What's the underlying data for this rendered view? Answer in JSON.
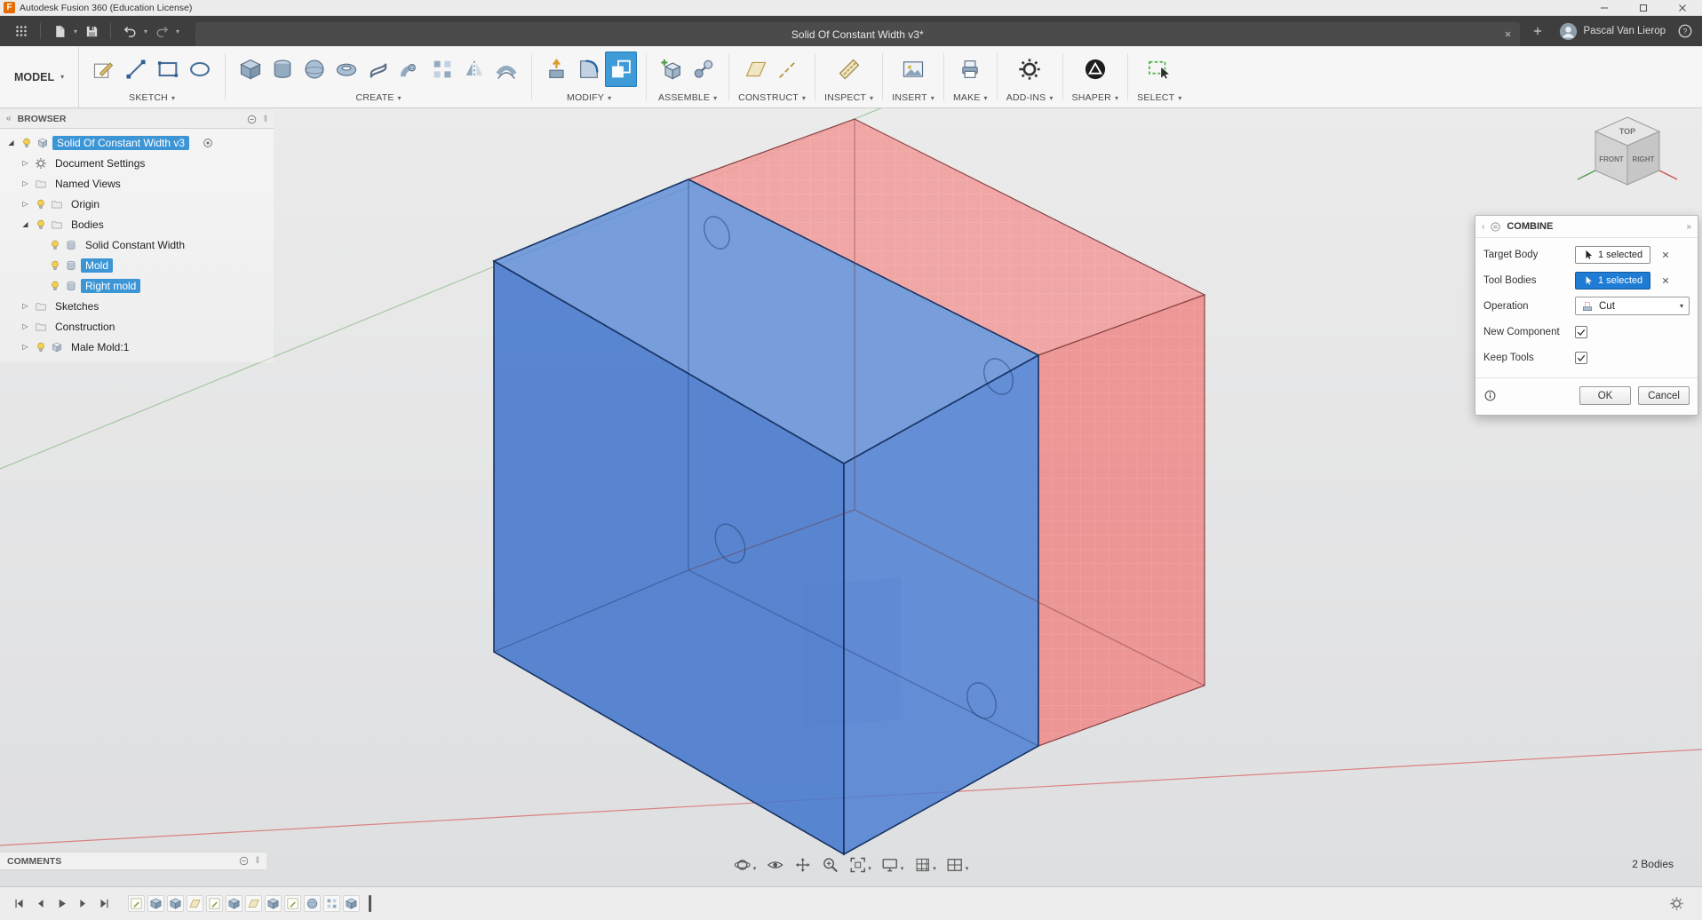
{
  "window": {
    "title": "Autodesk Fusion 360 (Education License)"
  },
  "appbar": {
    "tab_title": "Solid Of Constant Width v3*",
    "user_name": "Pascal Van Lierop"
  },
  "ribbon": {
    "workspace": "MODEL",
    "groups": [
      {
        "label": "SKETCH",
        "icons": [
          {
            "name": "create-sketch"
          },
          {
            "name": "sketch-line"
          },
          {
            "name": "sketch-rectangle"
          },
          {
            "name": "sketch-ellipse"
          }
        ]
      },
      {
        "label": "CREATE",
        "icons": [
          {
            "name": "box"
          },
          {
            "name": "cylinder"
          },
          {
            "name": "sphere"
          },
          {
            "name": "torus"
          },
          {
            "name": "coil"
          },
          {
            "name": "pipe"
          },
          {
            "name": "pattern"
          },
          {
            "name": "mirror"
          },
          {
            "name": "thicken"
          }
        ]
      },
      {
        "label": "MODIFY",
        "icons": [
          {
            "name": "press-pull"
          },
          {
            "name": "fillet"
          },
          {
            "name": "combine",
            "active": true
          }
        ]
      },
      {
        "label": "ASSEMBLE",
        "icons": [
          {
            "name": "new-component"
          },
          {
            "name": "joint"
          }
        ]
      },
      {
        "label": "CONSTRUCT",
        "icons": [
          {
            "name": "construction-plane"
          },
          {
            "name": "construction-axis"
          }
        ]
      },
      {
        "label": "INSPECT",
        "icons": [
          {
            "name": "measure"
          }
        ]
      },
      {
        "label": "INSERT",
        "icons": [
          {
            "name": "insert-image"
          }
        ]
      },
      {
        "label": "MAKE",
        "icons": [
          {
            "name": "make"
          }
        ]
      },
      {
        "label": "ADD-INS",
        "icons": [
          {
            "name": "scripts-addins"
          }
        ]
      },
      {
        "label": "SHAPER",
        "icons": [
          {
            "name": "shaper"
          }
        ]
      },
      {
        "label": "SELECT",
        "icons": [
          {
            "name": "select-window"
          }
        ]
      }
    ]
  },
  "browser": {
    "header": "BROWSER",
    "items": [
      {
        "label": "Solid Of Constant Width v3",
        "depth": 0,
        "expander": "expanded",
        "icons": [
          "lightbulb",
          "component"
        ],
        "selected": true,
        "radio": true
      },
      {
        "label": "Document Settings",
        "depth": 1,
        "expander": "collapsed",
        "icons": [
          "gear"
        ]
      },
      {
        "label": "Named Views",
        "depth": 1,
        "expander": "collapsed",
        "icons": [
          "folder"
        ]
      },
      {
        "label": "Origin",
        "depth": 1,
        "expander": "collapsed",
        "icons": [
          "lightbulb",
          "folder"
        ]
      },
      {
        "label": "Bodies",
        "depth": 1,
        "expander": "expanded",
        "icons": [
          "lightbulb",
          "folder"
        ]
      },
      {
        "label": "Solid Constant Width",
        "depth": 2,
        "expander": "",
        "icons": [
          "lightbulb",
          "body"
        ]
      },
      {
        "label": "Mold",
        "depth": 2,
        "expander": "",
        "icons": [
          "lightbulb",
          "body"
        ],
        "selected": true
      },
      {
        "label": "Right mold",
        "depth": 2,
        "expander": "",
        "icons": [
          "lightbulb",
          "body"
        ],
        "selected": true
      },
      {
        "label": "Sketches",
        "depth": 1,
        "expander": "collapsed",
        "icons": [
          "folder"
        ]
      },
      {
        "label": "Construction",
        "depth": 1,
        "expander": "collapsed",
        "icons": [
          "folder"
        ]
      },
      {
        "label": "Male Mold:1",
        "depth": 1,
        "expander": "collapsed",
        "icons": [
          "lightbulb",
          "component"
        ]
      }
    ]
  },
  "viewcube": {
    "top": "TOP",
    "front": "FRONT",
    "right": "RIGHT"
  },
  "dialog": {
    "title": "COMBINE",
    "rows": [
      {
        "label": "Target Body",
        "type": "selection",
        "value": "1 selected",
        "active": false
      },
      {
        "label": "Tool Bodies",
        "type": "selection",
        "value": "1 selected",
        "active": true
      },
      {
        "label": "Operation",
        "type": "dropdown",
        "value": "Cut"
      },
      {
        "label": "New Component",
        "type": "checkbox",
        "checked": true
      },
      {
        "label": "Keep Tools",
        "type": "checkbox",
        "checked": true
      }
    ],
    "ok": "OK",
    "cancel": "Cancel"
  },
  "comments": {
    "header": "COMMENTS"
  },
  "navbar": {
    "buttons": [
      {
        "name": "orbit",
        "caret": true
      },
      {
        "name": "look-at",
        "caret": false
      },
      {
        "name": "pan",
        "caret": false
      },
      {
        "name": "zoom",
        "caret": false
      },
      {
        "name": "fit",
        "caret": true
      },
      {
        "name": "display-settings",
        "caret": true
      },
      {
        "name": "grid-settings",
        "caret": true
      },
      {
        "name": "viewports",
        "caret": true
      }
    ]
  },
  "status": {
    "selection_info": "2 Bodies"
  },
  "timeline": {
    "controls": [
      "skip-start",
      "step-back",
      "play",
      "step-forward",
      "skip-end"
    ],
    "features": [
      {
        "name": "sketch1",
        "kind": "sketch"
      },
      {
        "name": "extrude1",
        "kind": "solid"
      },
      {
        "name": "fillet1",
        "kind": "solid"
      },
      {
        "name": "plane1",
        "kind": "plane"
      },
      {
        "name": "sketch2",
        "kind": "sketch"
      },
      {
        "name": "extrude2",
        "kind": "solid"
      },
      {
        "name": "plane2",
        "kind": "plane"
      },
      {
        "name": "split1",
        "kind": "solid"
      },
      {
        "name": "sketch3",
        "kind": "sketch"
      },
      {
        "name": "sphere1",
        "kind": "sphere"
      },
      {
        "name": "pattern1",
        "kind": "pattern"
      },
      {
        "name": "combine1",
        "kind": "solid"
      }
    ]
  },
  "colors": {
    "accent": "#1f7cd4",
    "selection": "#3c96d6",
    "active_tool_bg": "#3f9bd8",
    "blue_top": "#5e8cd8",
    "blue_left": "#4577cd",
    "blue_right": "#4b7dd2",
    "red_top": "#f29a9a",
    "red_right": "#ef8888",
    "axis_x": "#d96a6a",
    "axis_y": "#6aa763"
  }
}
